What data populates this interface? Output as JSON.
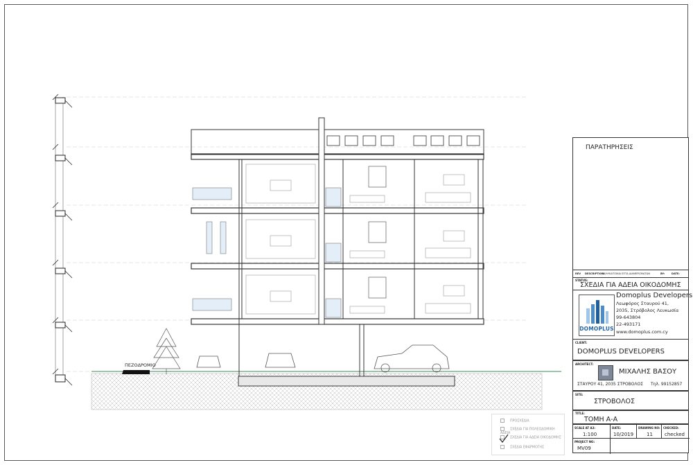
{
  "drawing": {
    "sidewalk_label": "ΠΕΖΟΔΡΟΜΙΟ"
  },
  "title_block": {
    "remarks_title": "ΠΑΡΑΤΗΡΗΣΕΙΣ",
    "rev_headers": {
      "rev": "REV",
      "description": "DESCRIPTION:",
      "description_value": "ΠΟΛΥΚΑΤΟΙΚΙΑ ΕΠΤΑ ΔΙΑΜΕΡΙΣΜΑΤΩΝ",
      "by": "BY:",
      "date": "DATE:"
    },
    "status_label": "STATUS:",
    "status_value": "ΣΧΕΔΙΑ ΓΙΑ ΑΔΕΙΑ ΟΙΚΟΔΟΜΗΣ",
    "company": {
      "name": "Domoplus Developers",
      "logo_text": "DOMOPLUS",
      "address_line1": "Λεωφόρος Σταυρού 41,",
      "address_line2": "2035, Στρόβολος Λευκωσία",
      "phone1": "99-643804",
      "phone2": "22-493171",
      "website": "www.domoplus.com.cy"
    },
    "client_label": "CLIENT:",
    "client_value": "DOMOPLUS DEVELOPERS",
    "architect_label": "ARCHITECT:",
    "architect_value": "ΜΙΧΑΛΗΣ ΒΑΣΟΥ",
    "architect_address": "ΣΤΑΥΡΟΥ 41, 2035 ΣΤΡΟΒΟΛΟΣ",
    "architect_phone": "Τηλ. 99152857",
    "site_label": "SITE:",
    "site_value": "ΣΤΡΟΒΟΛΟΣ",
    "title_label": "TITLE:",
    "title_value": "ΤΟΜΗ Α-Α",
    "scale_label": "SCALE AT A3:",
    "scale_value": "1:100",
    "date_label": "DATE:",
    "date_value": "10/2019",
    "drawing_no_label": "DRAWING NO:",
    "drawing_no_value": "11",
    "checked_label": "CHECKED:",
    "checked_value": "checked",
    "project_no_label": "PROJECT NO:",
    "project_no_value": "MV09"
  },
  "legend": {
    "items": [
      "ΠΡΟΣΧΕΔΙΑ",
      "ΣΧΕΔΙΑ ΓΙΑ ΠΟΛΕΟΔΟΜΙΚΗ ΑΔΕΙΑ",
      "ΣΧΕΔΙΑ ΓΙΑ ΑΔΕΙΑ ΟΙΚΟΔΟΜΗΣ",
      "ΣΧΕΔΙΑ ΕΦΑΡΜΟΓΗΣ"
    ],
    "checked_index": 2
  }
}
